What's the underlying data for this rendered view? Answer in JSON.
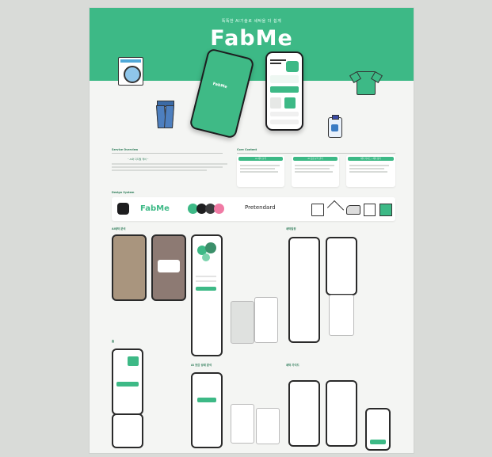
{
  "hero": {
    "tagline": "똑똑한 AI기술로 세탁을 더 쉽게",
    "logo": "FabMe",
    "phone_mark": "FabMe"
  },
  "sections": {
    "service_overview": "Service Overview",
    "core_content": "Core Content",
    "design_system": "Design System"
  },
  "service_overview": {
    "quote": "“ AI와 디지털 케어 ”"
  },
  "core_cards": [
    {
      "title": "AI 세탁 분석"
    },
    {
      "title": "AI 옷감 분석 관리"
    },
    {
      "title": "세탁 가이드 / 세탁 정리"
    }
  ],
  "design_system": {
    "logo": "FabMe",
    "typeface": "Pretendard"
  },
  "screens": {
    "left_title": "AI세탁 분석",
    "right_title": "세탁일정",
    "home_title": "홈",
    "fabric_title": "AI 옷감 상태 분석",
    "guide_title": "세탁 가이드"
  },
  "colors": {
    "brand": "#3db986",
    "dark": "#1d1d1f",
    "pink": "#f07aa4",
    "board": "#f4f5f3"
  }
}
